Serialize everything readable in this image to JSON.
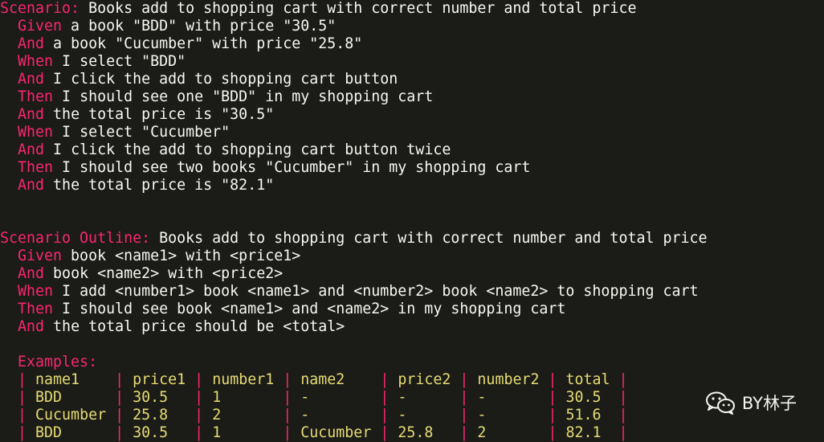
{
  "scenario": {
    "keyword": "Scenario:",
    "title": " Books add to shopping cart with correct number and total price",
    "steps": [
      {
        "keyword": "Given",
        "text": " a book \"BDD\" with price \"30.5\""
      },
      {
        "keyword": "And",
        "text": " a book \"Cucumber\" with price \"25.8\""
      },
      {
        "keyword": "When",
        "text": " I select \"BDD\""
      },
      {
        "keyword": "And",
        "text": " I click the add to shopping cart button"
      },
      {
        "keyword": "Then",
        "text": " I should see one \"BDD\" in my shopping cart"
      },
      {
        "keyword": "And",
        "text": " the total price is \"30.5\""
      },
      {
        "keyword": "When",
        "text": " I select \"Cucumber\""
      },
      {
        "keyword": "And",
        "text": " I click the add to shopping cart button twice"
      },
      {
        "keyword": "Then",
        "text": " I should see two books \"Cucumber\" in my shopping cart"
      },
      {
        "keyword": "And",
        "text": " the total price is \"82.1\""
      }
    ]
  },
  "outline": {
    "keyword": "Scenario Outline:",
    "title": " Books add to shopping cart with correct number and total price",
    "steps": [
      {
        "keyword": "Given",
        "text": " book <name1> with <price1>"
      },
      {
        "keyword": "And",
        "text": " book <name2> with <price2>"
      },
      {
        "keyword": "When",
        "text": " I add <number1> book <name1> and <number2> book <name2> to shopping cart"
      },
      {
        "keyword": "Then",
        "text": " I should see book <name1> and <name2> in my shopping cart"
      },
      {
        "keyword": "And",
        "text": " the total price should be <total>"
      }
    ],
    "examples_label": "Examples:",
    "table": {
      "header": [
        " name1    ",
        " price1 ",
        " number1 ",
        " name2    ",
        " price2 ",
        " number2 ",
        " total "
      ],
      "rows": [
        [
          " BDD      ",
          " 30.5   ",
          " 1       ",
          " -        ",
          " -      ",
          " -       ",
          " 30.5  "
        ],
        [
          " Cucumber ",
          " 25.8   ",
          " 2       ",
          " -        ",
          " -      ",
          " -       ",
          " 51.6  "
        ],
        [
          " BDD      ",
          " 30.5   ",
          " 1       ",
          " Cucumber ",
          " 25.8   ",
          " 2       ",
          " 82.1  "
        ]
      ]
    }
  },
  "watermark": {
    "text": "BY林子",
    "icon": "wechat-icon"
  }
}
